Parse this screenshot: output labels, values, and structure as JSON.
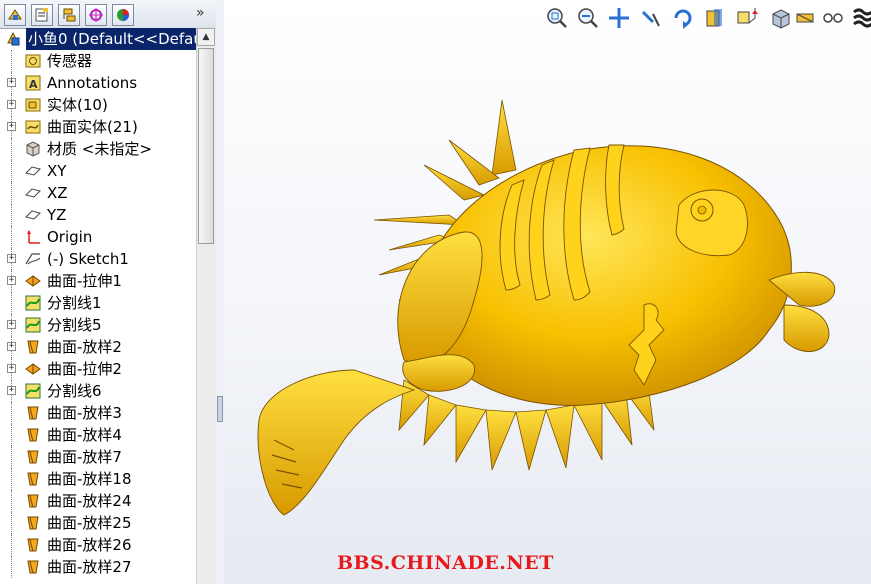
{
  "panel": {
    "tabs": [
      {
        "icon": "feature-manager-icon"
      },
      {
        "icon": "property-manager-icon"
      },
      {
        "icon": "configuration-manager-icon"
      },
      {
        "icon": "dimxpert-icon"
      },
      {
        "icon": "display-manager-icon"
      }
    ],
    "more": "»",
    "tree": [
      {
        "label": "小鱼0  (Default<<Defau",
        "icon": "part-icon",
        "expander": "",
        "root": true
      },
      {
        "label": "传感器",
        "icon": "sensor-icon",
        "expander": ""
      },
      {
        "label": "Annotations",
        "icon": "annotations-icon",
        "expander": "+"
      },
      {
        "label": "实体(10)",
        "icon": "solid-bodies-icon",
        "expander": "+"
      },
      {
        "label": "曲面实体(21)",
        "icon": "surface-bodies-icon",
        "expander": "+"
      },
      {
        "label": "材质 <未指定>",
        "icon": "material-icon",
        "expander": ""
      },
      {
        "label": "XY",
        "icon": "plane-icon",
        "expander": ""
      },
      {
        "label": "XZ",
        "icon": "plane-icon",
        "expander": ""
      },
      {
        "label": "YZ",
        "icon": "plane-icon",
        "expander": ""
      },
      {
        "label": "Origin",
        "icon": "origin-icon",
        "expander": ""
      },
      {
        "label": "(-) Sketch1",
        "icon": "sketch-icon",
        "expander": "+"
      },
      {
        "label": "曲面-拉伸1",
        "icon": "surface-extrude-icon",
        "expander": "+"
      },
      {
        "label": "分割线1",
        "icon": "split-line-icon",
        "expander": ""
      },
      {
        "label": "分割线5",
        "icon": "split-line-icon",
        "expander": "+"
      },
      {
        "label": "曲面-放样2",
        "icon": "surface-loft-icon",
        "expander": "+"
      },
      {
        "label": "曲面-拉伸2",
        "icon": "surface-extrude-icon",
        "expander": "+"
      },
      {
        "label": "分割线6",
        "icon": "split-line-icon",
        "expander": "+"
      },
      {
        "label": "曲面-放样3",
        "icon": "surface-loft-icon",
        "expander": ""
      },
      {
        "label": "曲面-放样4",
        "icon": "surface-loft-icon",
        "expander": ""
      },
      {
        "label": "曲面-放样7",
        "icon": "surface-loft-icon",
        "expander": ""
      },
      {
        "label": "曲面-放样18",
        "icon": "surface-loft-icon",
        "expander": ""
      },
      {
        "label": "曲面-放样24",
        "icon": "surface-loft-icon",
        "expander": ""
      },
      {
        "label": "曲面-放样25",
        "icon": "surface-loft-icon",
        "expander": ""
      },
      {
        "label": "曲面-放样26",
        "icon": "surface-loft-icon",
        "expander": ""
      },
      {
        "label": "曲面-放样27",
        "icon": "surface-loft-icon",
        "expander": ""
      }
    ]
  },
  "view_toolbar": [
    "zoom-to-fit-icon",
    "zoom-to-area-icon",
    "pan-icon",
    "previous-view-icon",
    "rotate-icon",
    "section-view-icon",
    "view-orientation-icon",
    "display-style-icon",
    "hide-show-icon",
    "edit-appearance-icon",
    "apply-scene-icon",
    "view-settings-icon",
    "realview-icon",
    "appearances-icon"
  ],
  "model": {
    "name": "fish-model",
    "color": "#f5b800"
  },
  "watermark": "BBS.CHINADE.NET",
  "colors": {
    "selection": "#0a246a",
    "model_yellow": "#f8c000",
    "watermark": "#e8191c"
  }
}
